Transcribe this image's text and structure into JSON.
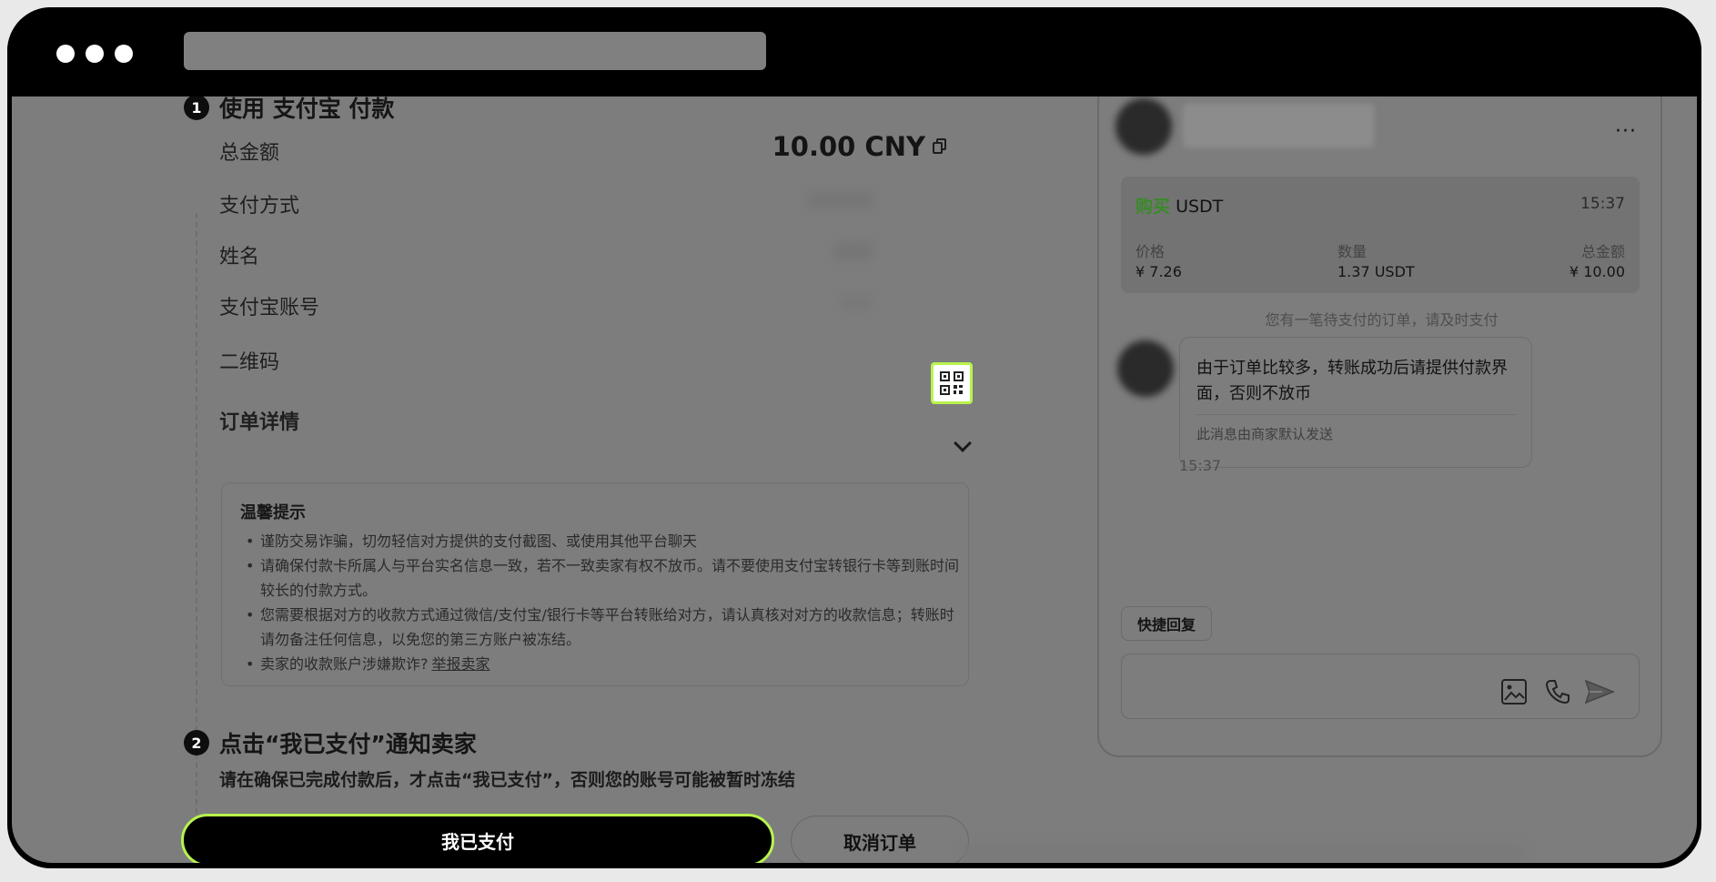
{
  "step1": {
    "number": "1",
    "title": "使用 支付宝 付款",
    "rows": {
      "total_label": "总金额",
      "total_value": "10.00 CNY",
      "method_label": "支付方式",
      "name_label": "姓名",
      "account_label": "支付宝账号",
      "qr_label": "二维码"
    },
    "details_label": "订单详情",
    "tips": {
      "title": "温馨提示",
      "items": [
        "谨防交易诈骗，切勿轻信对方提供的支付截图、或使用其他平台聊天",
        "请确保付款卡所属人与平台实名信息一致，若不一致卖家有权不放币。请不要使用支付宝转银行卡等到账时间较长的付款方式。",
        "您需要根据对方的收款方式通过微信/支付宝/银行卡等平台转账给对方，请认真核对对方的收款信息；转账时请勿备注任何信息，以免您的第三方账户被冻结。",
        "卖家的收款账户涉嫌欺诈?"
      ],
      "report_link": "举报卖家"
    }
  },
  "step2": {
    "number": "2",
    "title": "点击“我已支付”通知卖家",
    "subtitle": "请在确保已完成付款后，才点击“我已支付”，否则您的账号可能被暂时冻结"
  },
  "buttons": {
    "paid": "我已支付",
    "cancel": "取消订单"
  },
  "chat": {
    "more": "···",
    "order": {
      "action": "购买",
      "asset": "USDT",
      "time": "15:37",
      "price_label": "价格",
      "price_value": "¥ 7.26",
      "qty_label": "数量",
      "qty_value": "1.37 USDT",
      "total_label": "总金额",
      "total_value": "¥ 10.00"
    },
    "system_message": "您有一笔待支付的订单，请及时支付",
    "message": {
      "text": "由于订单比较多，转账成功后请提供付款界面，否则不放币",
      "note": "此消息由商家默认发送",
      "time": "15:37"
    },
    "quick_reply": "快捷回复"
  },
  "colors": {
    "accent": "#b7f34d",
    "buy_green": "#3a8a2a"
  },
  "icons": [
    "copy-icon",
    "qr-code-icon",
    "chevron-down-icon",
    "more-icon",
    "image-icon",
    "phone-icon",
    "send-icon"
  ]
}
